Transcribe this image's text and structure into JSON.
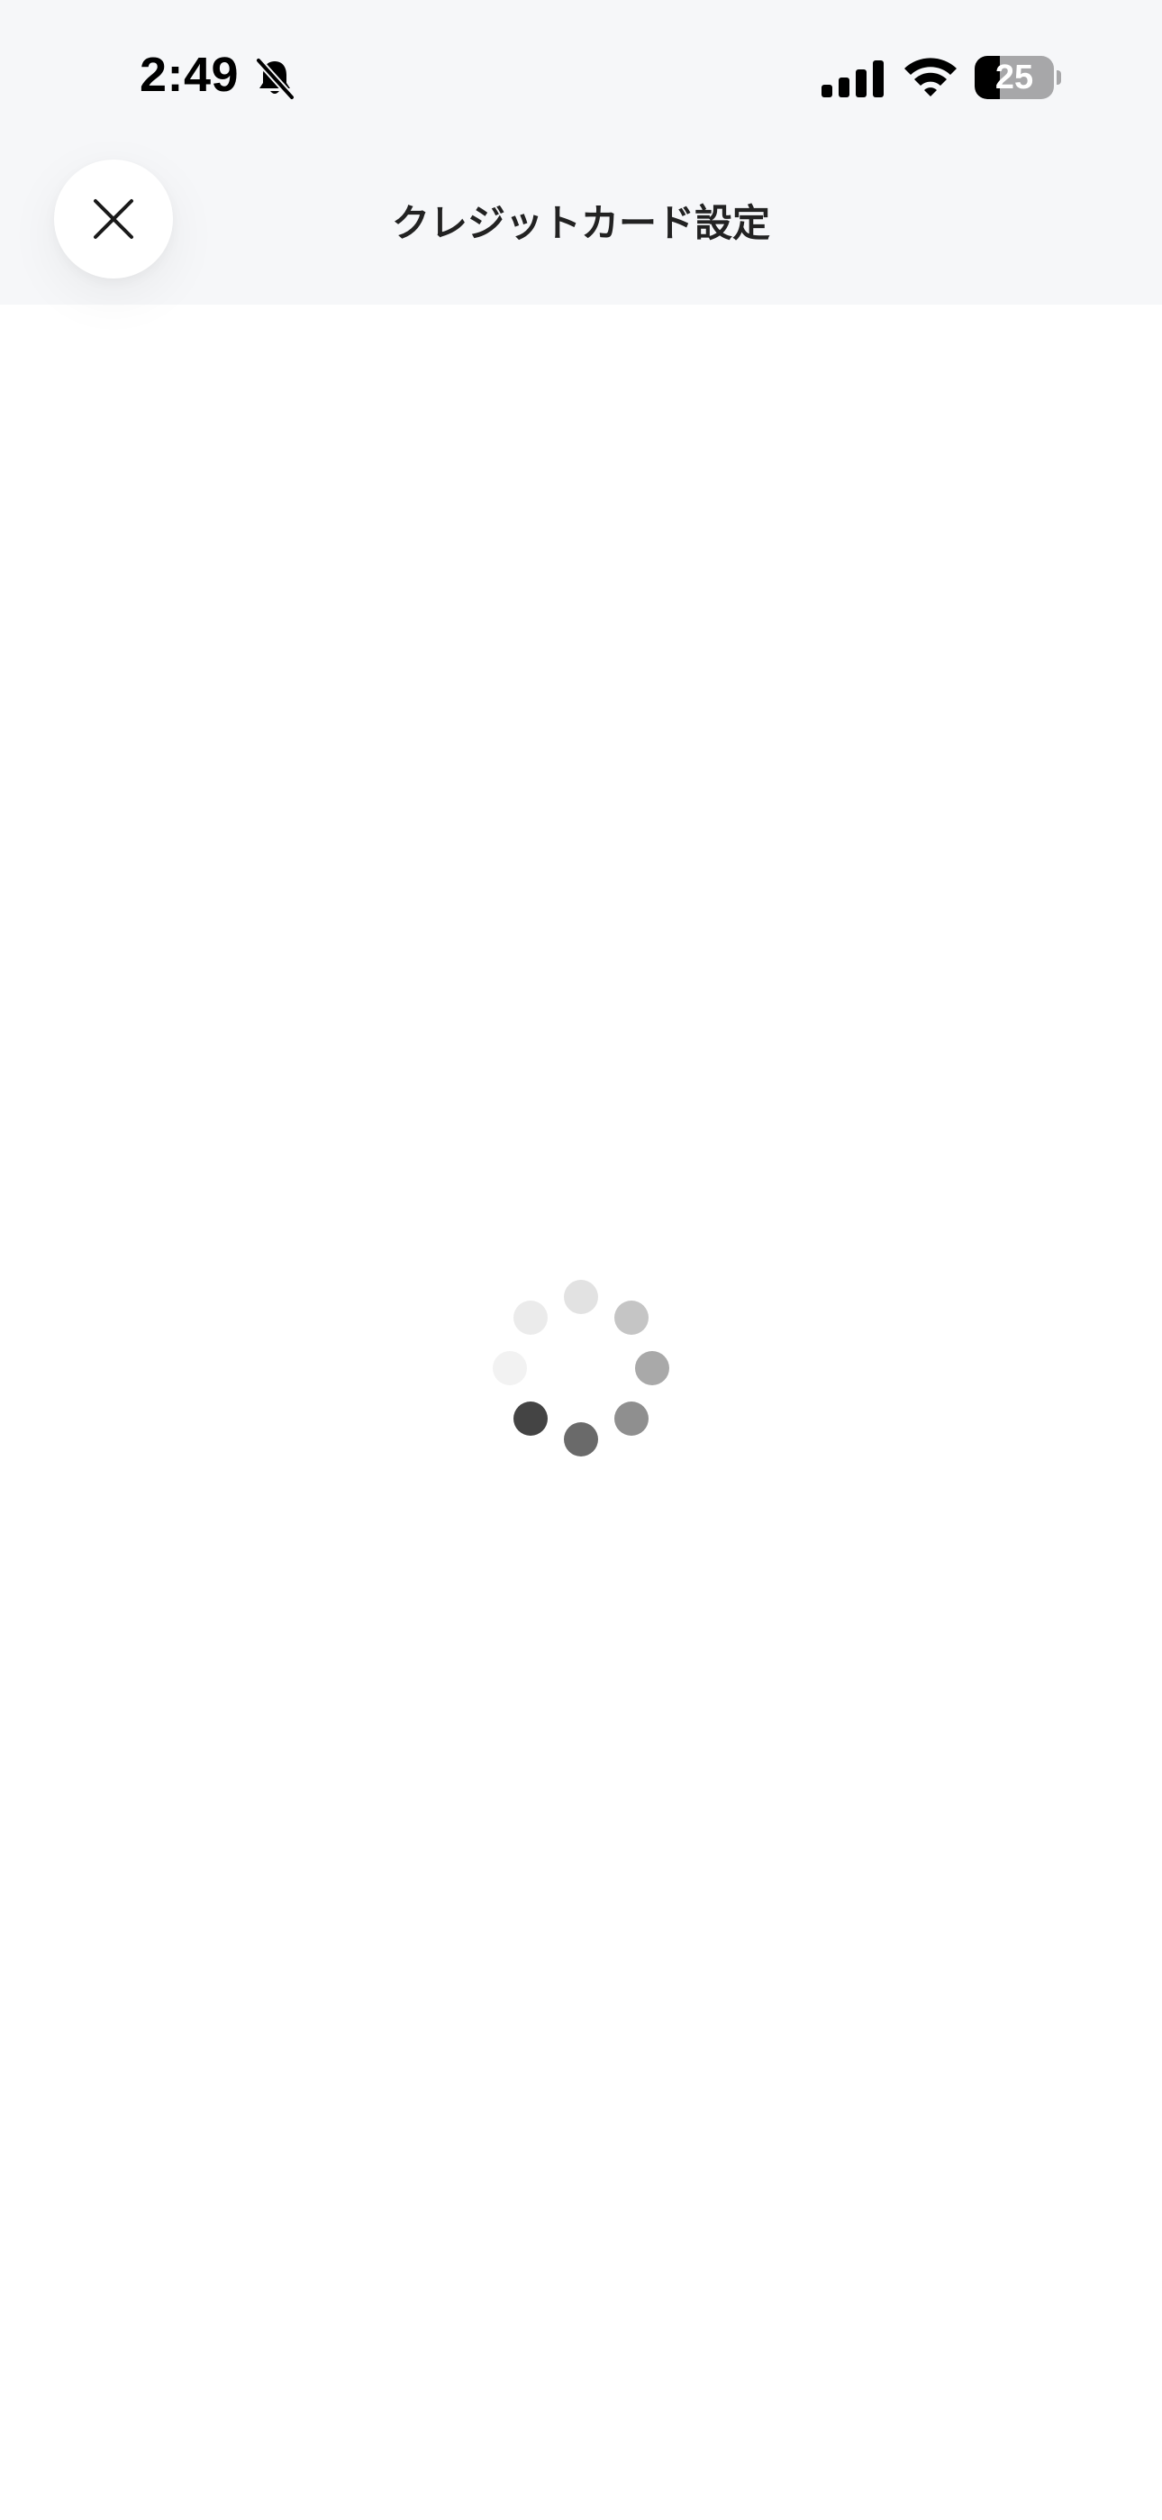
{
  "status_bar": {
    "time": "2:49",
    "battery_level": "25",
    "battery_fraction": 0.25,
    "icons": [
      "bell-slash-icon",
      "cellular-signal-icon",
      "wifi-icon",
      "battery-icon"
    ]
  },
  "nav": {
    "title": "クレジットカード設定",
    "close_icon": "close-icon"
  },
  "loading": {
    "icon": "loading-spinner-icon",
    "dot_colors": [
      "#e2e2e2",
      "#c5c5c5",
      "#a9a9a9",
      "#8f8f8f",
      "#6a6a6a",
      "#444444",
      "#f2f2f2",
      "#ebebeb"
    ]
  },
  "colors": {
    "header_bg": "#f6f7f9",
    "page_bg": "#ffffff",
    "title_text": "#222222"
  }
}
